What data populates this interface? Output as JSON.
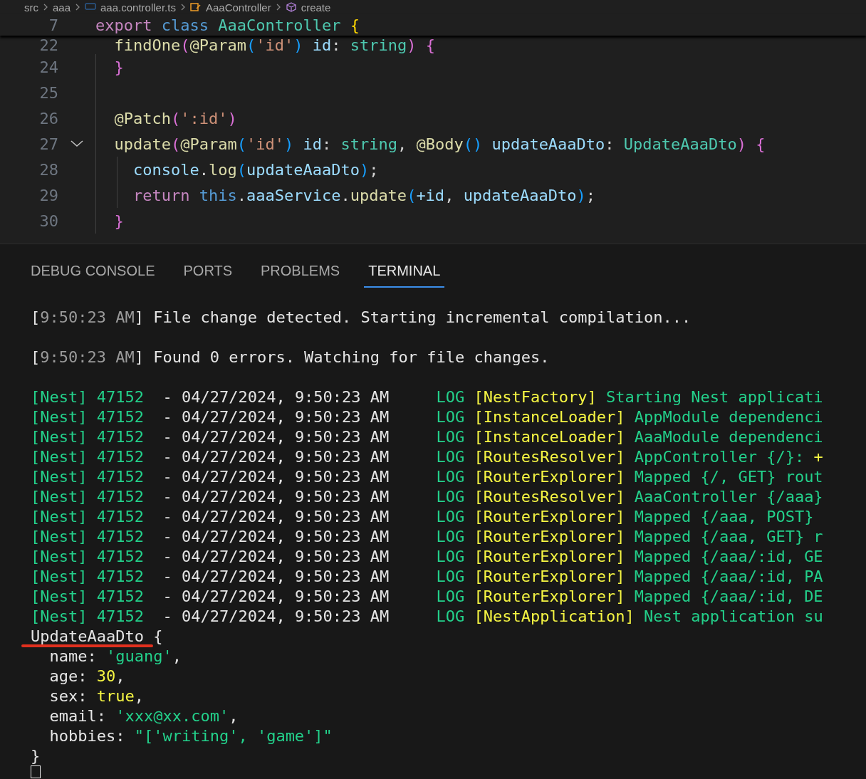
{
  "breadcrumb": [
    {
      "label": "src",
      "kind": "folder"
    },
    {
      "label": "aaa",
      "kind": "folder"
    },
    {
      "label": "aaa.controller.ts",
      "kind": "ts"
    },
    {
      "label": "AaaController",
      "kind": "class"
    },
    {
      "label": "create",
      "kind": "method"
    }
  ],
  "editor": {
    "sticky": {
      "number": "7",
      "tokens": [
        {
          "t": "export ",
          "kind": "kw"
        },
        {
          "t": "class ",
          "kind": "storage"
        },
        {
          "t": "AaaController ",
          "kind": "cls"
        },
        {
          "t": "{",
          "kind": "b1"
        }
      ]
    },
    "lines": [
      {
        "number": "22",
        "tokens": [
          {
            "t": "  findOne",
            "kind": "fn"
          },
          {
            "t": "(",
            "kind": "b2"
          },
          {
            "t": "@Param",
            "kind": "fn"
          },
          {
            "t": "(",
            "kind": "b3"
          },
          {
            "t": "'id'",
            "kind": "str"
          },
          {
            "t": ")",
            "kind": "b3"
          },
          {
            "t": " id",
            "kind": "var"
          },
          {
            "t": ": ",
            "kind": "p"
          },
          {
            "t": "string",
            "kind": "cls"
          },
          {
            "t": ")",
            "kind": "b2"
          },
          {
            "t": " {",
            "kind": "b2"
          }
        ]
      },
      {
        "number": "24",
        "tokens": [
          {
            "t": "  }",
            "kind": "b2"
          }
        ]
      },
      {
        "number": "25"
      },
      {
        "number": "26",
        "tokens": [
          {
            "t": "  @Patch",
            "kind": "fn"
          },
          {
            "t": "(",
            "kind": "b2"
          },
          {
            "t": "':id'",
            "kind": "str"
          },
          {
            "t": ")",
            "kind": "b2"
          }
        ]
      },
      {
        "number": "27",
        "fold": true,
        "tokens": [
          {
            "t": "  update",
            "kind": "fn"
          },
          {
            "t": "(",
            "kind": "b2"
          },
          {
            "t": "@Param",
            "kind": "fn"
          },
          {
            "t": "(",
            "kind": "b3"
          },
          {
            "t": "'id'",
            "kind": "str"
          },
          {
            "t": ")",
            "kind": "b3"
          },
          {
            "t": " id",
            "kind": "var"
          },
          {
            "t": ": ",
            "kind": "p"
          },
          {
            "t": "string",
            "kind": "cls"
          },
          {
            "t": ", ",
            "kind": "p"
          },
          {
            "t": "@Body",
            "kind": "fn"
          },
          {
            "t": "()",
            "kind": "b3"
          },
          {
            "t": " updateAaaDto",
            "kind": "var"
          },
          {
            "t": ": ",
            "kind": "p"
          },
          {
            "t": "UpdateAaaDto",
            "kind": "cls"
          },
          {
            "t": ")",
            "kind": "b2"
          },
          {
            "t": " {",
            "kind": "b2"
          }
        ]
      },
      {
        "number": "28",
        "tokens": [
          {
            "t": "    console",
            "kind": "var"
          },
          {
            "t": ".",
            "kind": "p"
          },
          {
            "t": "log",
            "kind": "fn"
          },
          {
            "t": "(",
            "kind": "b3"
          },
          {
            "t": "updateAaaDto",
            "kind": "var"
          },
          {
            "t": ")",
            "kind": "b3"
          },
          {
            "t": ";",
            "kind": "p"
          }
        ]
      },
      {
        "number": "29",
        "tokens": [
          {
            "t": "    return ",
            "kind": "kw"
          },
          {
            "t": "this",
            "kind": "storage"
          },
          {
            "t": ".",
            "kind": "p"
          },
          {
            "t": "aaaService",
            "kind": "var"
          },
          {
            "t": ".",
            "kind": "p"
          },
          {
            "t": "update",
            "kind": "fn"
          },
          {
            "t": "(",
            "kind": "b3"
          },
          {
            "t": "+id",
            "kind": "var"
          },
          {
            "t": ", ",
            "kind": "p"
          },
          {
            "t": "updateAaaDto",
            "kind": "var"
          },
          {
            "t": ")",
            "kind": "b3"
          },
          {
            "t": ";",
            "kind": "p"
          }
        ]
      },
      {
        "number": "30",
        "tokens": [
          {
            "t": "  }",
            "kind": "b2"
          }
        ]
      }
    ]
  },
  "panel": {
    "tabs": [
      {
        "label": "DEBUG CONSOLE",
        "selected": false
      },
      {
        "label": "PORTS",
        "selected": false
      },
      {
        "label": "PROBLEMS",
        "selected": false
      },
      {
        "label": "TERMINAL",
        "selected": true
      }
    ],
    "terminal": [
      {
        "kind": "text",
        "tokens": [
          {
            "t": "[",
            "kind": "white"
          },
          {
            "t": "9:50:23 AM",
            "kind": "grey"
          },
          {
            "t": "] File change detected. Starting incremental compilation...",
            "kind": "white"
          }
        ]
      },
      {
        "kind": "blank"
      },
      {
        "kind": "text",
        "tokens": [
          {
            "t": "[",
            "kind": "white"
          },
          {
            "t": "9:50:23 AM",
            "kind": "grey"
          },
          {
            "t": "] Found 0 errors. Watching for file changes.",
            "kind": "white"
          }
        ]
      },
      {
        "kind": "blank"
      },
      {
        "kind": "text",
        "tokens": [
          {
            "t": "[Nest] 47152",
            "kind": "green"
          },
          {
            "t": "  - 04/27/2024, 9:50:23 AM     ",
            "kind": "white"
          },
          {
            "t": "LOG ",
            "kind": "green"
          },
          {
            "t": "[NestFactory]",
            "kind": "yellow"
          },
          {
            "t": " Starting Nest applicati",
            "kind": "green"
          }
        ]
      },
      {
        "kind": "text",
        "tokens": [
          {
            "t": "[Nest] 47152",
            "kind": "green"
          },
          {
            "t": "  - 04/27/2024, 9:50:23 AM     ",
            "kind": "white"
          },
          {
            "t": "LOG ",
            "kind": "green"
          },
          {
            "t": "[InstanceLoader]",
            "kind": "yellow"
          },
          {
            "t": " AppModule dependenci",
            "kind": "green"
          }
        ]
      },
      {
        "kind": "text",
        "tokens": [
          {
            "t": "[Nest] 47152",
            "kind": "green"
          },
          {
            "t": "  - 04/27/2024, 9:50:23 AM     ",
            "kind": "white"
          },
          {
            "t": "LOG ",
            "kind": "green"
          },
          {
            "t": "[InstanceLoader]",
            "kind": "yellow"
          },
          {
            "t": " AaaModule dependenci",
            "kind": "green"
          }
        ]
      },
      {
        "kind": "text",
        "tokens": [
          {
            "t": "[Nest] 47152",
            "kind": "green"
          },
          {
            "t": "  - 04/27/2024, 9:50:23 AM     ",
            "kind": "white"
          },
          {
            "t": "LOG ",
            "kind": "green"
          },
          {
            "t": "[RoutesResolver]",
            "kind": "yellow"
          },
          {
            "t": " AppController {/}: ",
            "kind": "green"
          },
          {
            "t": "+",
            "kind": "yellow"
          }
        ]
      },
      {
        "kind": "text",
        "tokens": [
          {
            "t": "[Nest] 47152",
            "kind": "green"
          },
          {
            "t": "  - 04/27/2024, 9:50:23 AM     ",
            "kind": "white"
          },
          {
            "t": "LOG ",
            "kind": "green"
          },
          {
            "t": "[RouterExplorer]",
            "kind": "yellow"
          },
          {
            "t": " Mapped {/, GET} rout",
            "kind": "green"
          }
        ]
      },
      {
        "kind": "text",
        "tokens": [
          {
            "t": "[Nest] 47152",
            "kind": "green"
          },
          {
            "t": "  - 04/27/2024, 9:50:23 AM     ",
            "kind": "white"
          },
          {
            "t": "LOG ",
            "kind": "green"
          },
          {
            "t": "[RoutesResolver]",
            "kind": "yellow"
          },
          {
            "t": " AaaController {/aaa}",
            "kind": "green"
          }
        ]
      },
      {
        "kind": "text",
        "tokens": [
          {
            "t": "[Nest] 47152",
            "kind": "green"
          },
          {
            "t": "  - 04/27/2024, 9:50:23 AM     ",
            "kind": "white"
          },
          {
            "t": "LOG ",
            "kind": "green"
          },
          {
            "t": "[RouterExplorer]",
            "kind": "yellow"
          },
          {
            "t": " Mapped {/aaa, POST}",
            "kind": "green"
          }
        ]
      },
      {
        "kind": "text",
        "tokens": [
          {
            "t": "[Nest] 47152",
            "kind": "green"
          },
          {
            "t": "  - 04/27/2024, 9:50:23 AM     ",
            "kind": "white"
          },
          {
            "t": "LOG ",
            "kind": "green"
          },
          {
            "t": "[RouterExplorer]",
            "kind": "yellow"
          },
          {
            "t": " Mapped {/aaa, GET} r",
            "kind": "green"
          }
        ]
      },
      {
        "kind": "text",
        "tokens": [
          {
            "t": "[Nest] 47152",
            "kind": "green"
          },
          {
            "t": "  - 04/27/2024, 9:50:23 AM     ",
            "kind": "white"
          },
          {
            "t": "LOG ",
            "kind": "green"
          },
          {
            "t": "[RouterExplorer]",
            "kind": "yellow"
          },
          {
            "t": " Mapped {/aaa/:id, GE",
            "kind": "green"
          }
        ]
      },
      {
        "kind": "text",
        "tokens": [
          {
            "t": "[Nest] 47152",
            "kind": "green"
          },
          {
            "t": "  - 04/27/2024, 9:50:23 AM     ",
            "kind": "white"
          },
          {
            "t": "LOG ",
            "kind": "green"
          },
          {
            "t": "[RouterExplorer]",
            "kind": "yellow"
          },
          {
            "t": " Mapped {/aaa/:id, PA",
            "kind": "green"
          }
        ]
      },
      {
        "kind": "text",
        "tokens": [
          {
            "t": "[Nest] 47152",
            "kind": "green"
          },
          {
            "t": "  - 04/27/2024, 9:50:23 AM     ",
            "kind": "white"
          },
          {
            "t": "LOG ",
            "kind": "green"
          },
          {
            "t": "[RouterExplorer]",
            "kind": "yellow"
          },
          {
            "t": " Mapped {/aaa/:id, DE",
            "kind": "green"
          }
        ]
      },
      {
        "kind": "text",
        "tokens": [
          {
            "t": "[Nest] 47152",
            "kind": "green"
          },
          {
            "t": "  - 04/27/2024, 9:50:23 AM     ",
            "kind": "white"
          },
          {
            "t": "LOG ",
            "kind": "green"
          },
          {
            "t": "[NestApplication]",
            "kind": "yellow"
          },
          {
            "t": " Nest application su",
            "kind": "green"
          }
        ]
      },
      {
        "kind": "text",
        "underlined": true,
        "tokens": [
          {
            "t": "UpdateAaaDto",
            "kind": "white"
          },
          {
            "t": " {",
            "kind": "white"
          }
        ]
      },
      {
        "kind": "text",
        "tokens": [
          {
            "t": "  name: ",
            "kind": "white"
          },
          {
            "t": "'guang'",
            "kind": "green"
          },
          {
            "t": ",",
            "kind": "white"
          }
        ]
      },
      {
        "kind": "text",
        "tokens": [
          {
            "t": "  age: ",
            "kind": "white"
          },
          {
            "t": "30",
            "kind": "yellow"
          },
          {
            "t": ",",
            "kind": "white"
          }
        ]
      },
      {
        "kind": "text",
        "tokens": [
          {
            "t": "  sex: ",
            "kind": "white"
          },
          {
            "t": "true",
            "kind": "yellow"
          },
          {
            "t": ",",
            "kind": "white"
          }
        ]
      },
      {
        "kind": "text",
        "tokens": [
          {
            "t": "  email: ",
            "kind": "white"
          },
          {
            "t": "'xxx@xx.com'",
            "kind": "green"
          },
          {
            "t": ",",
            "kind": "white"
          }
        ]
      },
      {
        "kind": "text",
        "tokens": [
          {
            "t": "  hobbies: ",
            "kind": "white"
          },
          {
            "t": "\"['writing', 'game']\"",
            "kind": "green"
          }
        ]
      },
      {
        "kind": "text",
        "tokens": [
          {
            "t": "}",
            "kind": "white"
          }
        ]
      },
      {
        "kind": "cursor"
      }
    ]
  }
}
